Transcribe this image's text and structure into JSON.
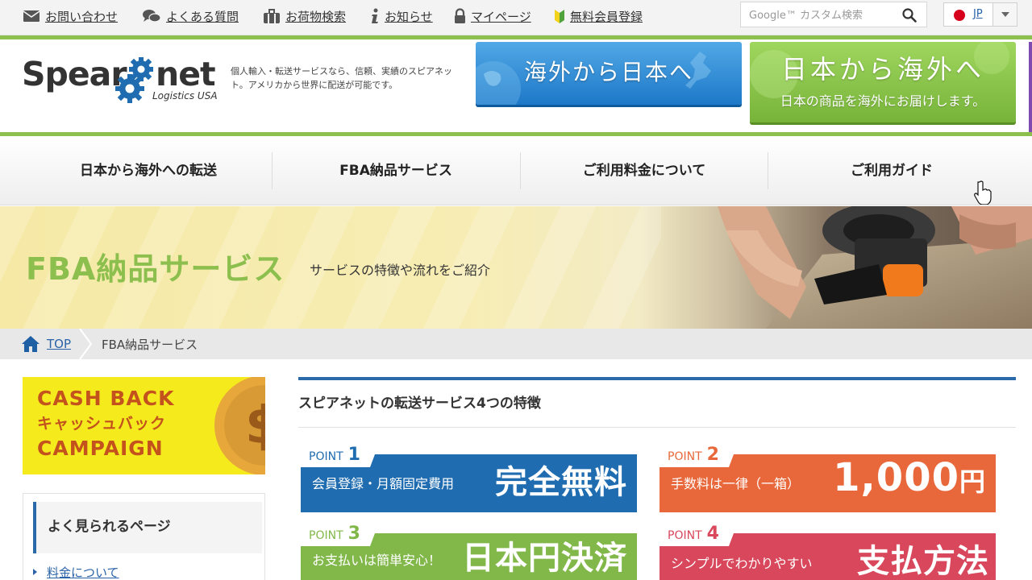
{
  "util_nav": [
    {
      "label": "お問い合わせ",
      "icon": "mail-icon"
    },
    {
      "label": "よくある質問",
      "icon": "chat-bubbles-icon"
    },
    {
      "label": "お荷物検索",
      "icon": "luggage-icon"
    },
    {
      "label": "お知らせ",
      "icon": "info-icon"
    },
    {
      "label": "マイページ",
      "icon": "lock-icon"
    },
    {
      "label": "無料会員登録",
      "icon": "beginner-mark-icon"
    }
  ],
  "search": {
    "placeholder": "Google™ カスタム検索"
  },
  "lang": {
    "code": "JP"
  },
  "logo": {
    "word1": "Spear",
    "word2": "net",
    "sub": "Logistics USA"
  },
  "tagline": "個人輸入・転送サービスなら、信頼、実績のスピアネット。アメリカから世界に配送が可能です。",
  "cta": {
    "inbound": "海外から日本へ",
    "outbound": "日本から海外へ",
    "outbound_sub": "日本の商品を海外にお届けします。"
  },
  "gnav": [
    "日本から海外への転送",
    "FBA納品サービス",
    "ご利用料金について",
    "ご利用ガイド"
  ],
  "hero": {
    "title": "FBA納品サービス",
    "subtitle": "サービスの特徴や流れをご紹介"
  },
  "breadcrumb": {
    "top": "TOP",
    "current": "FBA納品サービス"
  },
  "cashback": {
    "line1": "CASH BACK",
    "line2": "キャッシュバック",
    "line3": "CAMPAIGN"
  },
  "sidebar": {
    "heading": "よく見られるページ",
    "links": [
      "料金について"
    ]
  },
  "main": {
    "heading": "スピアネットの転送サービス4つの特徴"
  },
  "points": [
    {
      "tag": "POINT",
      "num": "1",
      "label": "会員登録・月額固定費用",
      "value": "完全無料",
      "unit": ""
    },
    {
      "tag": "POINT",
      "num": "2",
      "label": "手数料は一律（一箱）",
      "value": "1,000",
      "unit": "円"
    },
    {
      "tag": "POINT",
      "num": "3",
      "label": "お支払いは簡単安心！",
      "value": "日本円決済",
      "unit": ""
    },
    {
      "tag": "POINT",
      "num": "4",
      "label": "シンプルでわかりやすい",
      "value": "支払方法",
      "unit": ""
    }
  ],
  "colors": {
    "green": "#8cbf4d",
    "blue": "#1f6db0",
    "orange": "#e8683b",
    "lime": "#82b84a",
    "red": "#d8475b",
    "cashback_yellow": "#f4ea1c",
    "cashback_text": "#c3521d"
  }
}
